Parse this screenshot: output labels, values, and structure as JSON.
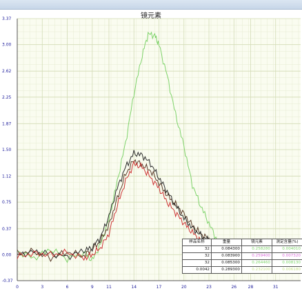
{
  "chart_data": {
    "type": "line",
    "title": "镜元素",
    "xlabel": "",
    "ylabel": "",
    "xlim": [
      0,
      34
    ],
    "ylim": [
      -0.37,
      3.37
    ],
    "x_ticks": [
      "0",
      "3",
      "6",
      "9",
      "11",
      "14",
      "17",
      "20",
      "23",
      "26",
      "28",
      "31"
    ],
    "x_tick_values": [
      0,
      3,
      6,
      9,
      11,
      14,
      17,
      20,
      23,
      26,
      28,
      31
    ],
    "y_ticks": [
      "-0.37",
      "0.00",
      "0.37",
      "0.75",
      "1.12",
      "1.50",
      "1.87",
      "2.25",
      "2.62",
      "3.00",
      "3.37"
    ],
    "y_tick_values": [
      -0.37,
      0.0,
      0.37,
      0.75,
      1.12,
      1.5,
      1.87,
      2.25,
      2.62,
      3.0,
      3.37
    ],
    "grid": true,
    "series": [
      {
        "color": "#7ed36a",
        "x": [
          0,
          2,
          4,
          6,
          8,
          9,
          10,
          11,
          12,
          13,
          14,
          15,
          15.7,
          16.5,
          17,
          18,
          19,
          20,
          21,
          22,
          23,
          24,
          25,
          26,
          27,
          28,
          29,
          30,
          31,
          32,
          33.5
        ],
        "y": [
          0.05,
          -0.05,
          0.08,
          -0.06,
          0.03,
          -0.08,
          0.15,
          0.5,
          1.05,
          1.6,
          2.3,
          2.85,
          3.15,
          3.13,
          3.0,
          2.55,
          2.0,
          1.55,
          1.0,
          0.7,
          0.45,
          0.2,
          0.1,
          0.05,
          0.08,
          -0.02,
          0.05,
          0.0,
          0.06,
          0.0,
          0.03
        ]
      },
      {
        "color": "#5a3a28",
        "x": [
          0,
          2,
          4,
          6,
          8,
          9,
          10,
          11,
          12,
          13,
          14,
          15,
          16,
          17,
          18,
          19,
          20,
          21,
          22,
          23,
          24,
          25,
          26,
          27,
          28,
          29,
          30,
          31,
          32,
          33.5
        ],
        "y": [
          0.02,
          0.05,
          -0.05,
          0.04,
          -0.02,
          0.08,
          0.2,
          0.42,
          0.8,
          1.15,
          1.35,
          1.28,
          1.2,
          1.02,
          0.85,
          0.72,
          0.58,
          0.42,
          0.3,
          0.22,
          0.15,
          0.08,
          0.04,
          0.02,
          0.05,
          -0.02,
          0.03,
          0.0,
          0.04,
          0.0
        ]
      },
      {
        "color": "#2a2a2a",
        "x": [
          0,
          2,
          4,
          6,
          8,
          9,
          10,
          11,
          12,
          13,
          14,
          15,
          16,
          17,
          18,
          19,
          20,
          21,
          22,
          23,
          24,
          25,
          26,
          27,
          28,
          29,
          30,
          31,
          32,
          33.5
        ],
        "y": [
          0.0,
          0.04,
          0.02,
          -0.03,
          0.06,
          0.1,
          0.25,
          0.55,
          0.95,
          1.25,
          1.45,
          1.42,
          1.3,
          1.1,
          0.9,
          0.7,
          0.52,
          0.38,
          0.28,
          0.2,
          0.14,
          0.1,
          0.05,
          0.03,
          0.02,
          0.04,
          0.01,
          0.03,
          0.0,
          0.02
        ]
      },
      {
        "color": "#cc3333",
        "x": [
          0,
          2,
          4,
          6,
          8,
          9,
          10,
          11,
          12,
          13,
          14,
          15,
          16,
          17,
          18,
          19,
          20,
          21,
          22,
          23,
          24,
          25,
          26,
          27,
          28,
          29,
          30,
          31,
          32,
          33.5
        ],
        "y": [
          -0.03,
          0.02,
          0.0,
          0.03,
          -0.05,
          0.0,
          0.1,
          0.3,
          0.7,
          1.05,
          1.3,
          1.25,
          1.1,
          0.95,
          0.75,
          0.6,
          0.45,
          0.32,
          0.2,
          0.1,
          0.05,
          0.0,
          -0.03,
          0.02,
          -0.02,
          0.0,
          0.02,
          -0.01,
          0.0,
          0.01
        ]
      }
    ],
    "legend": {
      "position": "bottom-right",
      "headers": [
        "样品名称",
        "重量",
        "镜元素",
        "测定含量(%)"
      ],
      "rows": [
        {
          "name": "32",
          "weight": "0.084300",
          "measured": "0.258280",
          "content": "0.004010",
          "color": "#7ed36a"
        },
        {
          "name": "32",
          "weight": "0.083900",
          "measured": "0.259400",
          "content": "0.007320",
          "color": "#d86ad8"
        },
        {
          "name": "32",
          "weight": "0.085300",
          "measured": "0.264460",
          "content": "0.008130",
          "color": "#7ed36a"
        },
        {
          "name": "0.0042",
          "weight": "0.289300",
          "measured": "0.232100",
          "content": "0.006180",
          "color": "#c8e08a"
        }
      ]
    }
  }
}
